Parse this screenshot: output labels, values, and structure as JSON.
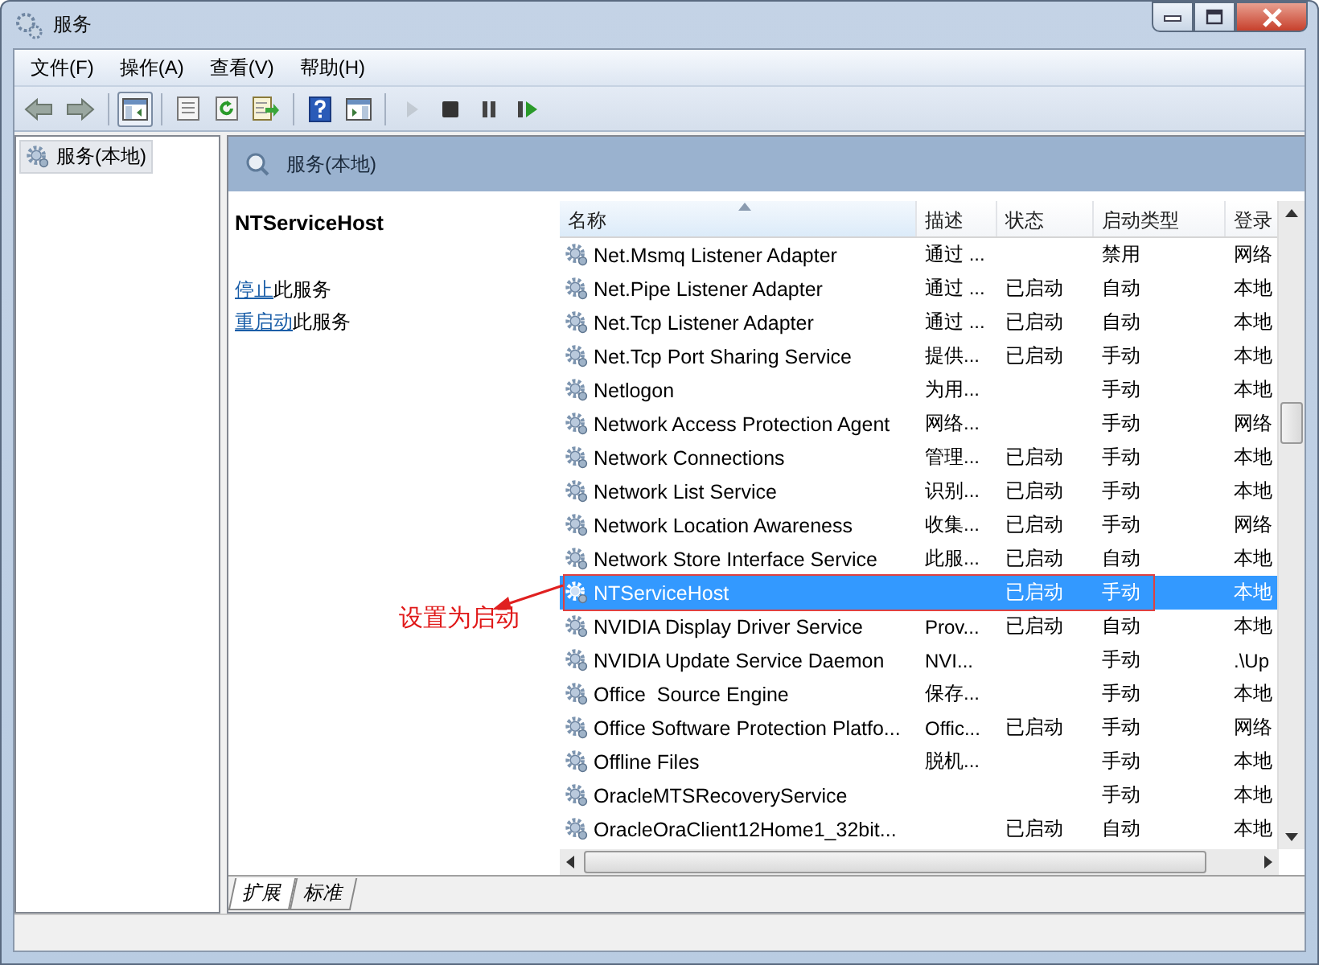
{
  "window": {
    "title": "服务"
  },
  "menu": [
    "文件(F)",
    "操作(A)",
    "查看(V)",
    "帮助(H)"
  ],
  "toolbar": [
    [
      {
        "kind": "back",
        "disabled": false
      },
      {
        "kind": "forward",
        "disabled": false
      }
    ],
    [
      {
        "kind": "tree",
        "disabled": false
      }
    ],
    [
      {
        "kind": "properties",
        "disabled": false
      },
      {
        "kind": "refresh",
        "disabled": false
      },
      {
        "kind": "export",
        "disabled": false
      }
    ],
    [
      {
        "kind": "help",
        "disabled": false
      },
      {
        "kind": "view",
        "disabled": false
      }
    ],
    [
      {
        "kind": "play",
        "disabled": true
      },
      {
        "kind": "stop",
        "disabled": false
      },
      {
        "kind": "pause",
        "disabled": false
      },
      {
        "kind": "resume",
        "disabled": false
      }
    ]
  ],
  "tree": [
    {
      "label": "服务(本地)",
      "selected": true
    }
  ],
  "panel_header": "服务(本地)",
  "detail": {
    "title": "NTServiceHost",
    "actions": [
      {
        "link": "停止",
        "text": "此服务"
      },
      {
        "link": "重启动",
        "text": "此服务"
      }
    ]
  },
  "table": {
    "columns": [
      {
        "label": "名称",
        "sorted": true
      },
      {
        "label": "描述",
        "sorted": false
      },
      {
        "label": "状态",
        "sorted": false
      },
      {
        "label": "启动类型",
        "sorted": false
      },
      {
        "label": "登录",
        "sorted": false
      }
    ],
    "rows": [
      {
        "name": "Net.Msmq Listener Adapter",
        "description": "通过 ...",
        "status": "",
        "startup": "禁用",
        "logon": "网络",
        "selected": false
      },
      {
        "name": "Net.Pipe Listener Adapter",
        "description": "通过 ...",
        "status": "已启动",
        "startup": "自动",
        "logon": "本地",
        "selected": false
      },
      {
        "name": "Net.Tcp Listener Adapter",
        "description": "通过 ...",
        "status": "已启动",
        "startup": "自动",
        "logon": "本地",
        "selected": false
      },
      {
        "name": "Net.Tcp Port Sharing Service",
        "description": "提供...",
        "status": "已启动",
        "startup": "手动",
        "logon": "本地",
        "selected": false
      },
      {
        "name": "Netlogon",
        "description": "为用...",
        "status": "",
        "startup": "手动",
        "logon": "本地",
        "selected": false
      },
      {
        "name": "Network Access Protection Agent",
        "description": "网络...",
        "status": "",
        "startup": "手动",
        "logon": "网络",
        "selected": false
      },
      {
        "name": "Network Connections",
        "description": "管理...",
        "status": "已启动",
        "startup": "手动",
        "logon": "本地",
        "selected": false
      },
      {
        "name": "Network List Service",
        "description": "识别...",
        "status": "已启动",
        "startup": "手动",
        "logon": "本地",
        "selected": false
      },
      {
        "name": "Network Location Awareness",
        "description": "收集...",
        "status": "已启动",
        "startup": "手动",
        "logon": "网络",
        "selected": false
      },
      {
        "name": "Network Store Interface Service",
        "description": "此服...",
        "status": "已启动",
        "startup": "自动",
        "logon": "本地",
        "selected": false
      },
      {
        "name": "NTServiceHost",
        "description": "",
        "status": "已启动",
        "startup": "手动",
        "logon": "本地",
        "selected": true
      },
      {
        "name": "NVIDIA Display Driver Service",
        "description": "Prov...",
        "status": "已启动",
        "startup": "自动",
        "logon": "本地",
        "selected": false
      },
      {
        "name": "NVIDIA Update Service Daemon",
        "description": "NVI...",
        "status": "",
        "startup": "手动",
        "logon": ".\\Up",
        "selected": false
      },
      {
        "name": "Office  Source Engine",
        "description": "保存...",
        "status": "",
        "startup": "手动",
        "logon": "本地",
        "selected": false
      },
      {
        "name": "Office Software Protection Platfo...",
        "description": "Offic...",
        "status": "已启动",
        "startup": "手动",
        "logon": "网络",
        "selected": false
      },
      {
        "name": "Offline Files",
        "description": "脱机...",
        "status": "",
        "startup": "手动",
        "logon": "本地",
        "selected": false
      },
      {
        "name": "OracleMTSRecoveryService",
        "description": "",
        "status": "",
        "startup": "手动",
        "logon": "本地",
        "selected": false
      },
      {
        "name": "OracleOraClient12Home1_32bit...",
        "description": "",
        "status": "已启动",
        "startup": "自动",
        "logon": "本地",
        "selected": false
      }
    ]
  },
  "tabs": [
    {
      "label": "扩展",
      "selected": true
    },
    {
      "label": "标准",
      "selected": false
    }
  ],
  "annotation": {
    "text": "设置为启动"
  }
}
